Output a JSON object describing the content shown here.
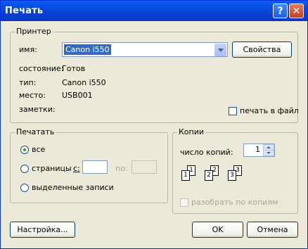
{
  "title": "Печать",
  "titlebar_buttons": {
    "help": "?",
    "close": "✕"
  },
  "printer": {
    "legend": "Принтер",
    "name_label": "имя:",
    "name_value": "Canon i550",
    "properties_button": "Свойства",
    "status_label": "состояние:",
    "status_value": "Готов",
    "type_label": "тип:",
    "type_value": "Canon i550",
    "location_label": "место:",
    "location_value": "USB001",
    "comment_label": "заметки:",
    "print_to_file_label": "печать в файл"
  },
  "print_range": {
    "legend": "Печатать",
    "all_label": "все",
    "pages_label": "страницы",
    "from_label": "с:",
    "to_label": "по:",
    "from_value": "",
    "to_value": "",
    "selection_label": "выделенные записи"
  },
  "copies": {
    "legend": "Копии",
    "count_label": "число копий:",
    "count_value": "1",
    "collate_label": "разобрать по копиям",
    "page_numbers": [
      "1",
      "1",
      "2",
      "2",
      "3",
      "3"
    ]
  },
  "buttons": {
    "setup": "Настройка...",
    "ok": "OK",
    "cancel": "Отмена"
  }
}
